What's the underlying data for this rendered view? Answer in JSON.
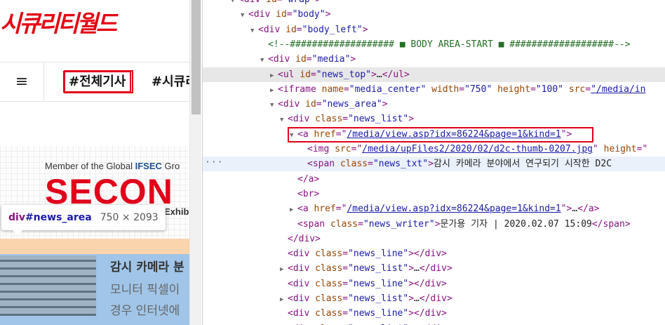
{
  "site": {
    "logo_text": "시큐리티월드",
    "menu_icon_glyph": "≡",
    "nav_tabs": [
      "#전체기사",
      "#시큐리"
    ],
    "banner": {
      "member_prefix": "Member of the Global ",
      "member_brand": "IFSEC",
      "member_suffix": " Gro",
      "title": "SECON",
      "sub": "Exhib"
    },
    "tooltip": {
      "tag": "div",
      "id": "#news_area",
      "size": "750 × 2093"
    },
    "article": {
      "title": "감시 카메라 분",
      "line1": "모니터 픽셀이",
      "line2": "경우 인터넷에"
    }
  },
  "devtools": {
    "lines": [
      {
        "indent": 3,
        "tri": "▼",
        "parts": [
          [
            "t",
            "<div "
          ],
          [
            "a",
            "id"
          ],
          [
            "t",
            "="
          ],
          [
            "v",
            "\"wrap\""
          ],
          [
            "t",
            ">"
          ]
        ]
      },
      {
        "indent": 4,
        "tri": "▼",
        "parts": [
          [
            "t",
            "<div "
          ],
          [
            "a",
            "id"
          ],
          [
            "t",
            "="
          ],
          [
            "v",
            "\"body\""
          ],
          [
            "t",
            ">"
          ]
        ]
      },
      {
        "indent": 5,
        "tri": "▼",
        "parts": [
          [
            "t",
            "<div "
          ],
          [
            "a",
            "id"
          ],
          [
            "t",
            "="
          ],
          [
            "v",
            "\"body_left\""
          ],
          [
            "t",
            ">"
          ]
        ]
      },
      {
        "indent": 6,
        "tri": "",
        "parts": [
          [
            "c",
            "<!--################### ■ BODY AREA-START ■ ###################-->"
          ]
        ]
      },
      {
        "indent": 6,
        "tri": "▼",
        "parts": [
          [
            "t",
            "<div "
          ],
          [
            "a",
            "id"
          ],
          [
            "t",
            "="
          ],
          [
            "v",
            "\"media\""
          ],
          [
            "t",
            ">"
          ]
        ]
      },
      {
        "indent": 7,
        "tri": "▶",
        "hover": true,
        "parts": [
          [
            "t",
            "<ul "
          ],
          [
            "a",
            "id"
          ],
          [
            "t",
            "="
          ],
          [
            "v",
            "\"news_top\""
          ],
          [
            "t",
            ">"
          ],
          [
            "txt",
            "…"
          ],
          [
            "t",
            "</ul>"
          ]
        ]
      },
      {
        "indent": 7,
        "tri": "▶",
        "parts": [
          [
            "t",
            "<iframe "
          ],
          [
            "a",
            "name"
          ],
          [
            "t",
            "="
          ],
          [
            "v",
            "\"media_center\""
          ],
          [
            "t",
            " "
          ],
          [
            "a",
            "width"
          ],
          [
            "t",
            "="
          ],
          [
            "v",
            "\"750\""
          ],
          [
            "t",
            " "
          ],
          [
            "a",
            "height"
          ],
          [
            "t",
            "="
          ],
          [
            "v",
            "\"100\""
          ],
          [
            "t",
            " "
          ],
          [
            "a",
            "src"
          ],
          [
            "t",
            "="
          ],
          [
            "u",
            "\"/media/in"
          ]
        ]
      },
      {
        "indent": 7,
        "tri": "▼",
        "parts": [
          [
            "t",
            "<div "
          ],
          [
            "a",
            "id"
          ],
          [
            "t",
            "="
          ],
          [
            "v",
            "\"news_area\""
          ],
          [
            "t",
            ">"
          ]
        ]
      },
      {
        "indent": 8,
        "tri": "▼",
        "parts": [
          [
            "t",
            "<div "
          ],
          [
            "a",
            "class"
          ],
          [
            "t",
            "="
          ],
          [
            "v",
            "\"news_list\""
          ],
          [
            "t",
            ">"
          ]
        ]
      },
      {
        "indent": 9,
        "tri": "▼",
        "parts": [
          [
            "t",
            "<a "
          ],
          [
            "a",
            "href"
          ],
          [
            "t",
            "=\""
          ],
          [
            "u",
            "/media/view.asp?idx=86224&page=1&kind=1"
          ],
          [
            "t",
            "\">"
          ]
        ]
      },
      {
        "indent": 10,
        "tri": "",
        "parts": [
          [
            "t",
            "<img "
          ],
          [
            "a",
            "src"
          ],
          [
            "t",
            "=\""
          ],
          [
            "u",
            "/media/upFiles2/2020/02/d2c-thumb-0207.jpg"
          ],
          [
            "t",
            "\" "
          ],
          [
            "a",
            "height"
          ],
          [
            "t",
            "=\""
          ]
        ]
      },
      {
        "indent": 10,
        "tri": "",
        "sel": true,
        "parts": [
          [
            "t",
            "<span "
          ],
          [
            "a",
            "class"
          ],
          [
            "t",
            "="
          ],
          [
            "v",
            "\"news_txt\""
          ],
          [
            "t",
            ">"
          ],
          [
            "txt",
            "감시 카메라 분야에서 연구되기 시작한 D2C"
          ]
        ]
      },
      {
        "indent": 9,
        "tri": "",
        "parts": [
          [
            "t",
            "</a>"
          ]
        ]
      },
      {
        "indent": 9,
        "tri": "",
        "parts": [
          [
            "t",
            "<br>"
          ]
        ]
      },
      {
        "indent": 9,
        "tri": "▶",
        "parts": [
          [
            "t",
            "<a "
          ],
          [
            "a",
            "href"
          ],
          [
            "t",
            "=\""
          ],
          [
            "u",
            "/media/view.asp?idx=86224&page=1&kind=1"
          ],
          [
            "t",
            "\">"
          ],
          [
            "txt",
            "…"
          ],
          [
            "t",
            "</a>"
          ]
        ]
      },
      {
        "indent": 9,
        "tri": "",
        "parts": [
          [
            "t",
            "<span "
          ],
          [
            "a",
            "class"
          ],
          [
            "t",
            "="
          ],
          [
            "v",
            "\"news_writer\""
          ],
          [
            "t",
            ">"
          ],
          [
            "txt",
            "문가용 기자 | 2020.02.07 15:09"
          ],
          [
            "t",
            "</span>"
          ]
        ]
      },
      {
        "indent": 8,
        "tri": "",
        "parts": [
          [
            "t",
            "</div>"
          ]
        ]
      },
      {
        "indent": 8,
        "tri": "",
        "parts": [
          [
            "t",
            "<div "
          ],
          [
            "a",
            "class"
          ],
          [
            "t",
            "="
          ],
          [
            "v",
            "\"news_line\""
          ],
          [
            "t",
            ">"
          ],
          [
            "t",
            "</div>"
          ]
        ]
      },
      {
        "indent": 8,
        "tri": "▶",
        "parts": [
          [
            "t",
            "<div "
          ],
          [
            "a",
            "class"
          ],
          [
            "t",
            "="
          ],
          [
            "v",
            "\"news_list\""
          ],
          [
            "t",
            ">"
          ],
          [
            "txt",
            "…"
          ],
          [
            "t",
            "</div>"
          ]
        ]
      },
      {
        "indent": 8,
        "tri": "",
        "parts": [
          [
            "t",
            "<div "
          ],
          [
            "a",
            "class"
          ],
          [
            "t",
            "="
          ],
          [
            "v",
            "\"news_line\""
          ],
          [
            "t",
            ">"
          ],
          [
            "t",
            "</div>"
          ]
        ]
      },
      {
        "indent": 8,
        "tri": "▶",
        "parts": [
          [
            "t",
            "<div "
          ],
          [
            "a",
            "class"
          ],
          [
            "t",
            "="
          ],
          [
            "v",
            "\"news_list\""
          ],
          [
            "t",
            ">"
          ],
          [
            "txt",
            "…"
          ],
          [
            "t",
            "</div>"
          ]
        ]
      },
      {
        "indent": 8,
        "tri": "",
        "parts": [
          [
            "t",
            "<div "
          ],
          [
            "a",
            "class"
          ],
          [
            "t",
            "="
          ],
          [
            "v",
            "\"news_line\""
          ],
          [
            "t",
            ">"
          ],
          [
            "t",
            "</div>"
          ]
        ]
      },
      {
        "indent": 8,
        "tri": "▶",
        "parts": [
          [
            "t",
            "<div "
          ],
          [
            "a",
            "class"
          ],
          [
            "t",
            "="
          ],
          [
            "v",
            "\"news_list\""
          ],
          [
            "t",
            ">"
          ],
          [
            "txt",
            "…"
          ],
          [
            "t",
            "</div>"
          ]
        ]
      }
    ],
    "gutter_ellipsis": "···"
  }
}
